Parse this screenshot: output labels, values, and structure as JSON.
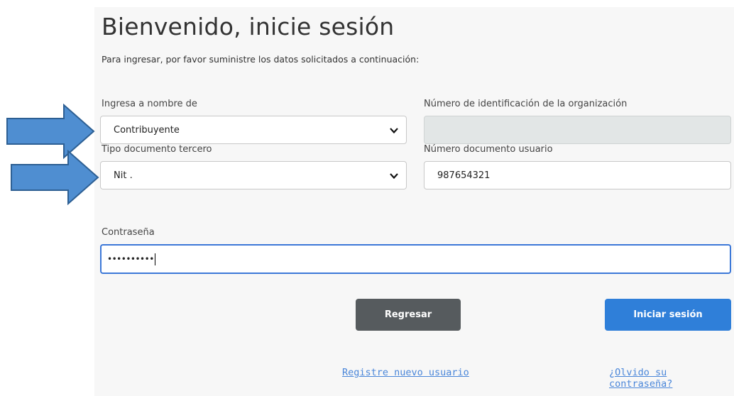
{
  "header": {
    "title": "Bienvenido, inicie sesión",
    "subtitle": "Para ingresar, por favor suministre los datos solicitados a continuación:"
  },
  "form": {
    "entity_type": {
      "label": "Ingresa a nombre de",
      "value": "Contribuyente"
    },
    "org_id": {
      "label": "Número de identificación de la organización",
      "value": ""
    },
    "doc_type": {
      "label": "Tipo documento tercero",
      "value": "Nit ."
    },
    "user_doc": {
      "label": "Número documento usuario",
      "value": "987654321"
    },
    "password": {
      "label": "Contraseña",
      "value": "••••••••••"
    }
  },
  "buttons": {
    "back": "Regresar",
    "login": "Iniciar sesión"
  },
  "links": {
    "register": "Registre nuevo usuario",
    "forgot": "¿Olvido su contraseña?"
  },
  "colors": {
    "primary": "#2f7fd9",
    "secondary": "#565b5e",
    "link": "#4a86d9",
    "arrow": "#4f8ed1"
  }
}
